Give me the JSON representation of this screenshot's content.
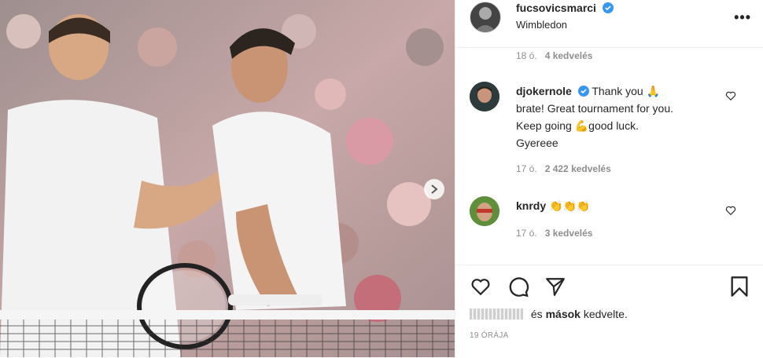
{
  "post": {
    "author": "fucsovicsmarci",
    "location": "Wimbledon",
    "photo_alt": "tennis players handshake at the net",
    "next_icon": "chevron-right-icon"
  },
  "comments_top": {
    "time": "18 ó.",
    "likes": "4 kedvelés"
  },
  "comments": [
    {
      "username": "djokernole",
      "verified": true,
      "lines": [
        "Thank you 🙏",
        "brate! Great tournament for you.",
        "Keep going 💪good luck.",
        "Gyereee"
      ],
      "time": "17 ó.",
      "likes": "2 422 kedvelés"
    },
    {
      "username": "knrdy",
      "verified": false,
      "text": "👏👏👏",
      "time": "17 ó.",
      "likes": "3 kedvelés"
    }
  ],
  "liked_by": {
    "conj": "és",
    "others": "mások",
    "suffix": "kedvelte."
  },
  "posted_ago": "19 ÓRÁJA",
  "colors": {
    "verified": "#3897f0",
    "muted": "#8e8e8e",
    "border": "#efefef"
  }
}
